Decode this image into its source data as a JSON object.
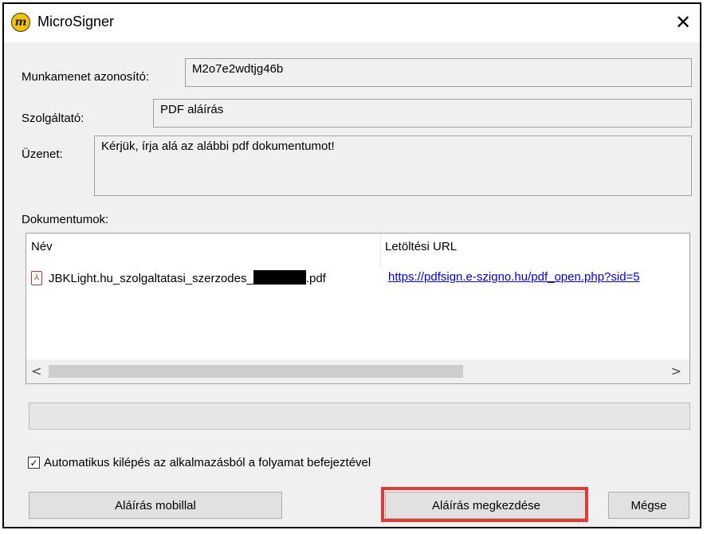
{
  "window": {
    "title": "MicroSigner",
    "icon_letter": "m",
    "close_glyph": "✕"
  },
  "session": {
    "label": "Munkamenet azonosító:",
    "value": "M2o7e2wdtjg46b"
  },
  "provider": {
    "label": "Szolgáltató:",
    "value": "PDF aláírás"
  },
  "message": {
    "label": "Üzenet:",
    "value": "Kérjük, írja alá az alábbi pdf dokumentumot!"
  },
  "documents": {
    "label": "Dokumentumok:",
    "columns": [
      "Név",
      "Letöltési URL"
    ],
    "rows": [
      {
        "name_prefix": "JBKLight.hu_szolgaltatasi_szerzodes_",
        "name_suffix": ".pdf",
        "url": "https://pdfsign.e-szigno.hu/pdf_open.php?sid=5"
      }
    ]
  },
  "auto_exit": {
    "checked": true,
    "label": "Automatikus kilépés az alkalmazásból a folyamat befejeztével"
  },
  "buttons": {
    "mobile": "Aláírás mobillal",
    "start": "Aláírás megkezdése",
    "cancel": "Mégse"
  },
  "colors": {
    "highlight": "#e53935",
    "link": "#0000ee",
    "icon_bg": "#f3c300"
  }
}
